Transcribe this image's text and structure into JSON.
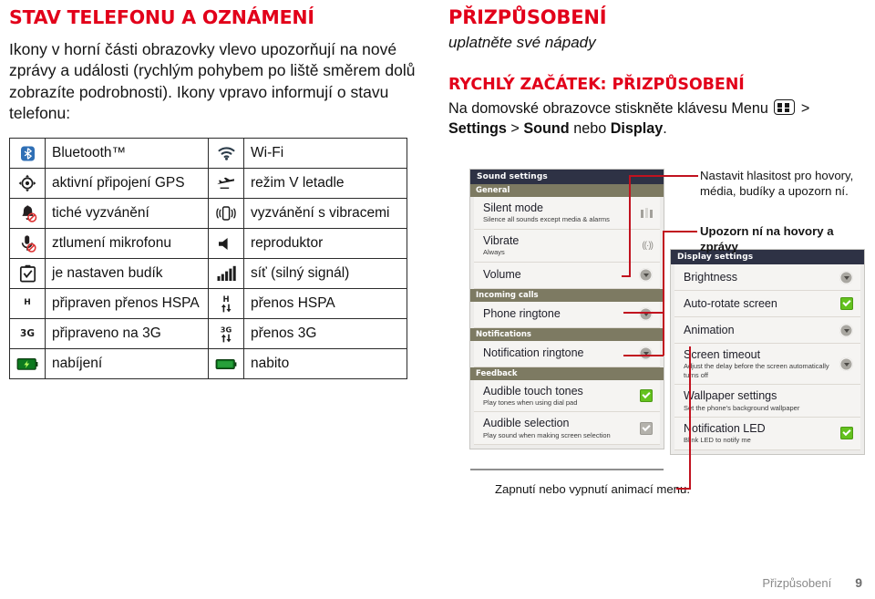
{
  "left": {
    "heading": "STAV TELEFONU A OZNÁMENÍ",
    "paragraph": "Ikony v horní části obrazovky vlevo upozorňují na nové zprávy a události (rychlým pohybem po liště směrem dolů zobrazíte podrobnosti). Ikony vpravo informují o stavu telefonu:",
    "table_rows": [
      {
        "left_icon": "bluetooth-icon",
        "left_label": "Bluetooth™",
        "right_icon": "wifi-icon",
        "right_label": "Wi-Fi"
      },
      {
        "left_icon": "gps-icon",
        "left_label": "aktivní připojení GPS",
        "right_icon": "airplane-icon",
        "right_label": "režim V letadle"
      },
      {
        "left_icon": "silent-ring-icon",
        "left_label": "tiché vyzvánění",
        "right_icon": "vibrate-icon",
        "right_label": "vyzvánění s vibracemi"
      },
      {
        "left_icon": "mic-mute-icon",
        "left_label": "ztlumení mikrofonu",
        "right_icon": "speaker-icon",
        "right_label": "reproduktor"
      },
      {
        "left_icon": "alarm-set-icon",
        "left_label": "je nastaven budík",
        "right_icon": "signal-bars-icon",
        "right_label": "síť (silný signál)"
      },
      {
        "left_icon": "hspa-ready-icon",
        "left_label": "připraven přenos HSPA",
        "right_icon": "hspa-transfer-icon",
        "right_label": "přenos HSPA"
      },
      {
        "left_icon": "3g-ready-icon",
        "left_label": "připraveno na 3G",
        "right_icon": "3g-transfer-icon",
        "right_label": "přenos 3G"
      },
      {
        "left_icon": "charging-icon",
        "left_label": "nabíjení",
        "right_icon": "battery-full-icon",
        "right_label": "nabito"
      }
    ]
  },
  "right": {
    "heading": "PŘIZPŮSOBENÍ",
    "subtitle": "uplatněte své nápady",
    "quickstart_title": "RYCHLÝ ZAČÁTEK: PŘIZPŮSOBENÍ",
    "quickstart_prefix": "Na domovské obrazovce stiskněte klávesu Menu",
    "quickstart_arrow": ">",
    "quickstart_path_1": "Settings",
    "quickstart_sep_1": ">",
    "quickstart_path_2": "Sound",
    "quickstart_or": "nebo",
    "quickstart_path_3": "Display",
    "quickstart_end": "."
  },
  "sound_panel": {
    "title": "Sound settings",
    "groups": [
      {
        "name": "General",
        "rows": [
          {
            "title": "Silent mode",
            "subtitle": "Silence all sounds except media & alarms",
            "control": "vibrate-bars-icon"
          },
          {
            "title": "Vibrate",
            "subtitle": "Always",
            "control": "vibrate-icon"
          },
          {
            "title": "Volume",
            "subtitle": "",
            "control": "chevron-down-icon"
          }
        ]
      },
      {
        "name": "Incoming calls",
        "rows": [
          {
            "title": "Phone ringtone",
            "subtitle": "",
            "control": "chevron-down-icon"
          }
        ]
      },
      {
        "name": "Notifications",
        "rows": [
          {
            "title": "Notification ringtone",
            "subtitle": "",
            "control": "chevron-down-icon"
          }
        ]
      },
      {
        "name": "Feedback",
        "rows": [
          {
            "title": "Audible touch tones",
            "subtitle": "Play tones when using dial pad",
            "control": "checkbox-checked"
          },
          {
            "title": "Audible selection",
            "subtitle": "Play sound when making screen selection",
            "control": "checkbox-disabled"
          }
        ]
      }
    ]
  },
  "display_panel": {
    "title": "Display settings",
    "rows": [
      {
        "title": "Brightness",
        "subtitle": "",
        "control": "chevron-down-icon"
      },
      {
        "title": "Auto-rotate screen",
        "subtitle": "",
        "control": "checkbox-checked"
      },
      {
        "title": "Animation",
        "subtitle": "",
        "control": "chevron-down-icon"
      },
      {
        "title": "Screen timeout",
        "subtitle": "Adjust the delay before the screen automatically turns off",
        "control": "chevron-down-icon"
      },
      {
        "title": "Wallpaper settings",
        "subtitle": "Set the phone's background wallpaper",
        "control": "none"
      },
      {
        "title": "Notification LED",
        "subtitle": "Blink LED to notify me",
        "control": "checkbox-checked"
      }
    ]
  },
  "callouts": {
    "volume": "Nastavit hlasitost pro hovory, média, budíky a upozorn ní.",
    "notify": "Upozorn ní na hovory a zprávy",
    "animation": "Zapnutí nebo vypnutí animací menu."
  },
  "footer": {
    "chapter": "Přizpůsobení",
    "page": "9"
  },
  "colors": {
    "accent_red": "#e2001a",
    "leader_red": "#c1121f",
    "panel_header": "#2e3245",
    "group_band": "#7d7a62",
    "checkbox_on": "#64c21e"
  }
}
